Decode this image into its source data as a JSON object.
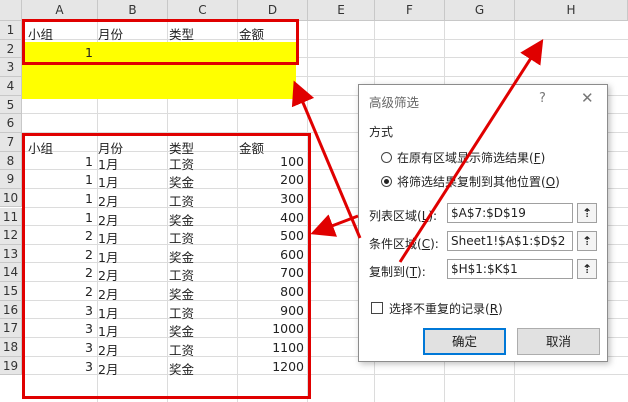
{
  "columns": [
    "A",
    "B",
    "C",
    "D",
    "E",
    "F",
    "G",
    "H"
  ],
  "rows": [
    "1",
    "2",
    "3",
    "4",
    "5",
    "6",
    "7",
    "8",
    "9",
    "10",
    "11",
    "12",
    "13",
    "14",
    "15",
    "16",
    "17",
    "18",
    "19"
  ],
  "criteria": {
    "headers": [
      "小组",
      "月份",
      "类型",
      "金额"
    ],
    "row2_group": "1"
  },
  "table": {
    "headers": [
      "小组",
      "月份",
      "类型",
      "金额"
    ],
    "rows": [
      [
        "1",
        "1月",
        "工资",
        "100"
      ],
      [
        "1",
        "1月",
        "奖金",
        "200"
      ],
      [
        "1",
        "2月",
        "工资",
        "300"
      ],
      [
        "1",
        "2月",
        "奖金",
        "400"
      ],
      [
        "2",
        "1月",
        "工资",
        "500"
      ],
      [
        "2",
        "1月",
        "奖金",
        "600"
      ],
      [
        "2",
        "2月",
        "工资",
        "700"
      ],
      [
        "2",
        "2月",
        "奖金",
        "800"
      ],
      [
        "3",
        "1月",
        "工资",
        "900"
      ],
      [
        "3",
        "1月",
        "奖金",
        "1000"
      ],
      [
        "3",
        "2月",
        "工资",
        "1100"
      ],
      [
        "3",
        "2月",
        "奖金",
        "1200"
      ]
    ]
  },
  "dialog": {
    "title": "高级筛选",
    "help": "?",
    "close": "✕",
    "section_label": "方式",
    "option1": "在原有区域显示筛选结果(",
    "option1_key": "F",
    "option2": "将筛选结果复制到其他位置(",
    "option2_key": "O",
    "list_range_label": "列表区域(",
    "list_range_key": "L",
    "list_range_value": "$A$7:$D$19",
    "criteria_range_label": "条件区域(",
    "criteria_range_key": "C",
    "criteria_range_value": "Sheet1!$A$1:$D$2",
    "copy_to_label": "复制到(",
    "copy_to_key": "T",
    "copy_to_value": "$H$1:$K$1",
    "unique_label": "选择不重复的记录(",
    "unique_key": "R",
    "ok_label": "确定",
    "cancel_label": "取消",
    "ref_icon": "range-select-icon"
  },
  "colors": {
    "highlight": "#ffff00",
    "annotation": "#e00000",
    "accent": "#0078d7"
  }
}
